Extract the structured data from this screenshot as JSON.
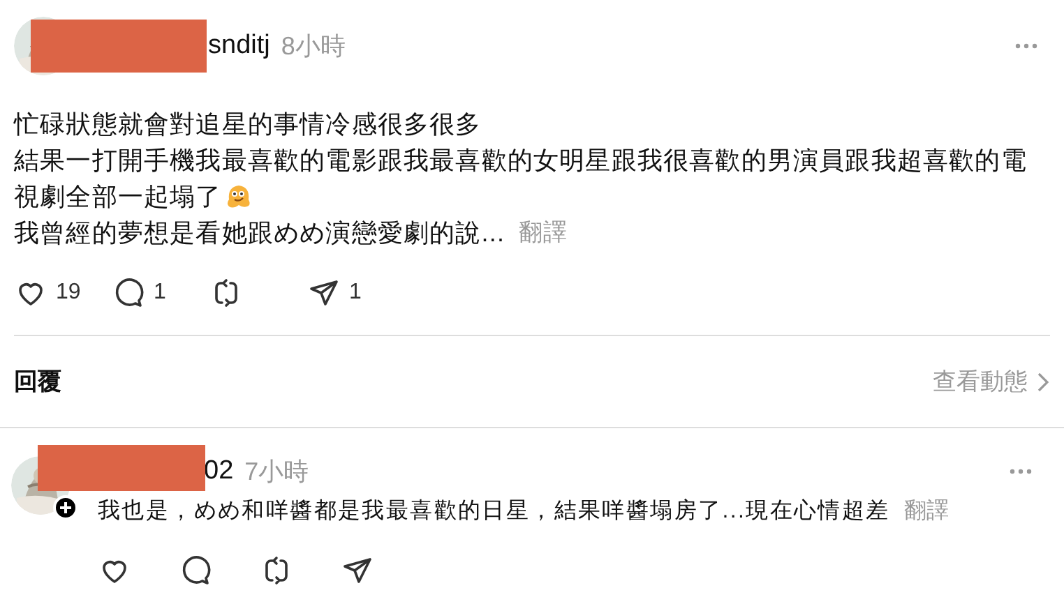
{
  "post": {
    "username": "snditj",
    "time": "8小時",
    "redacted": true,
    "lines": [
      {
        "text": "忙碌狀態就會對追星的事情冷感很多很多",
        "emoji": false
      },
      {
        "text": "結果一打開手機我最喜歡的電影跟我最喜歡的女明星跟我很喜歡的男演員跟我超喜歡的電",
        "emoji": false
      },
      {
        "text": "視劇全部一起塌了",
        "emoji": true
      },
      {
        "text": "我曾經的夢想是看她跟めめ演戀愛劇的說...",
        "emoji": false
      }
    ],
    "translate": "翻譯",
    "actions": [
      {
        "kind": "like",
        "count": "19"
      },
      {
        "kind": "comment",
        "count": "1"
      },
      {
        "kind": "repost"
      },
      {
        "kind": "share",
        "count": "1"
      }
    ]
  },
  "replies_bar": {
    "label": "回覆",
    "link": "查看動態"
  },
  "reply": {
    "username": "02",
    "time": "7小時",
    "redacted": true,
    "text": "我也是，めめ和咩醬都是我最喜歡的日星，結果咩醬塌房了...現在心情超差",
    "translate": "翻譯",
    "actions": [
      {
        "kind": "like"
      },
      {
        "kind": "comment"
      },
      {
        "kind": "repost"
      },
      {
        "kind": "share"
      }
    ]
  }
}
